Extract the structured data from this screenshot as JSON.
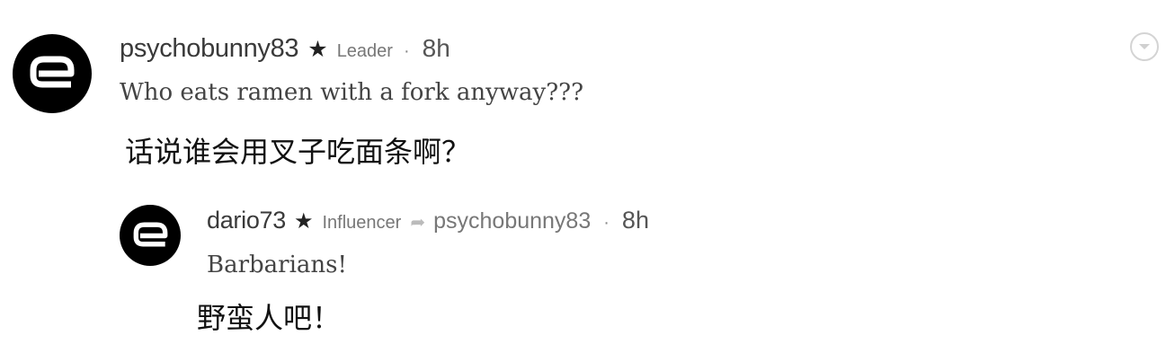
{
  "comment": {
    "avatar_icon": "e-logo-icon",
    "username": "psychobunny83",
    "star": "★",
    "badge": "Leader",
    "separator": "·",
    "time": "8h",
    "text": "Who eats ramen with a fork anyway???",
    "translation": "话说谁会用叉子吃面条啊？",
    "menu_icon": "chevron-down-icon"
  },
  "reply": {
    "avatar_icon": "e-logo-icon",
    "username": "dario73",
    "star": "★",
    "badge": "Influencer",
    "reply_arrow": "➦",
    "reply_to": "psychobunny83",
    "separator": "·",
    "time": "8h",
    "text": "Barbarians!",
    "translation": "野蛮人吧！"
  }
}
